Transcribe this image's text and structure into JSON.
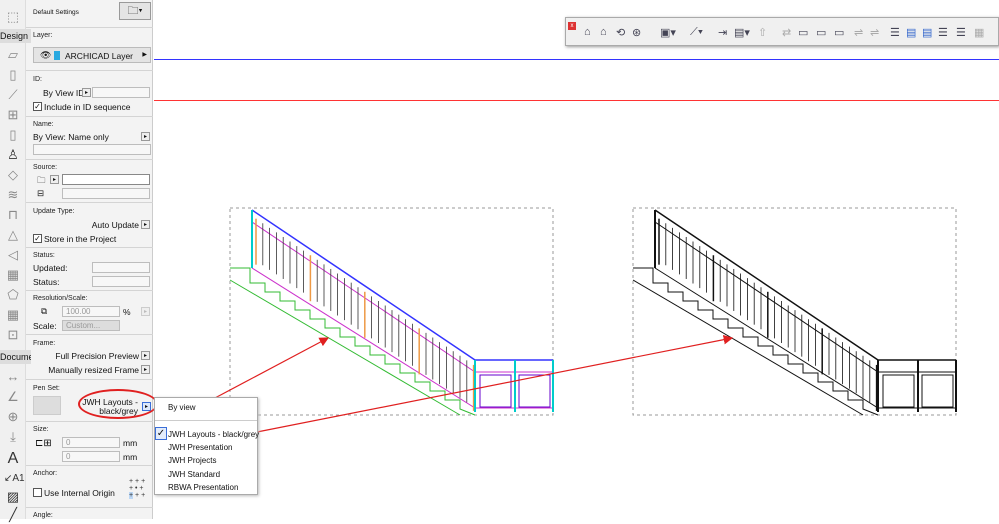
{
  "toolbox": {
    "design_label": "Design",
    "document_label": "Documen"
  },
  "panel": {
    "default_settings": "Default Settings",
    "layer_label": "Layer:",
    "layer_value": "ARCHICAD Layer",
    "id_label": "ID:",
    "id_mode": "By View ID",
    "include_id": "Include in ID sequence",
    "name_label": "Name:",
    "name_value": "By View: Name only",
    "source_label": "Source:",
    "update_type_label": "Update Type:",
    "update_type_value": "Auto Update",
    "store_label": "Store in the Project",
    "status_label": "Status:",
    "updated_label": "Updated:",
    "status_field_label": "Status:",
    "resolution_label": "Resolution/Scale:",
    "resolution_value": "100.00",
    "percent": "%",
    "scale_label": "Scale:",
    "scale_value": "Custom...",
    "frame_label": "Frame:",
    "frame_preview": "Full Precision Preview",
    "frame_size": "Manually resized Frame",
    "penset_label": "Pen Set:",
    "penset_value_1": "JWH Layouts -",
    "penset_value_2": "black/grey",
    "size_label": "Size:",
    "width_value": "0",
    "height_value": "0",
    "unit": "mm",
    "anchor_label": "Anchor:",
    "use_internal_origin": "Use Internal Origin",
    "angle_label": "Angle:"
  },
  "menu": {
    "by_view": "By view",
    "items": [
      "JWH Layouts - black/grey",
      "JWH Presentation",
      "JWH Projects",
      "JWH Standard",
      "RBWA Presentation"
    ],
    "selected": 0
  },
  "colors": {
    "highlight": "#e02020",
    "blue_line": "#3333ff",
    "red_line": "#ff3333"
  }
}
